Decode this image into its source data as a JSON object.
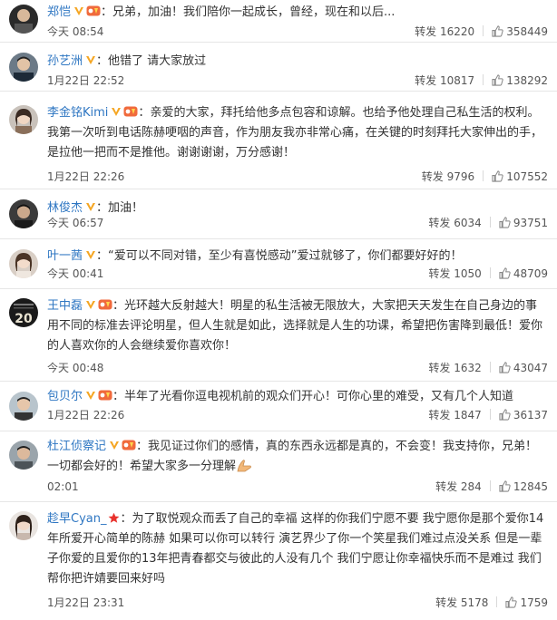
{
  "labels": {
    "repost": "转发"
  },
  "colors": {
    "username": "#2e76c2",
    "vip_badge": "#f5a623",
    "svip_badge": "#f06a3c",
    "star": "#e8322d"
  },
  "comments": [
    {
      "user": "郑恺",
      "badges": [
        "v-icon",
        "svip-icon"
      ],
      "text": "兄弟，加油！我们陪你一起成长，曾经，现在和以后...",
      "time": "今天 08:54",
      "repost_count": "16220",
      "likes": "358449"
    },
    {
      "user": "孙艺洲",
      "badges": [
        "v-icon"
      ],
      "text": "他错了 请大家放过",
      "time": "1月22日 22:52",
      "repost_count": "10817",
      "likes": "138292"
    },
    {
      "user": "李金铭Kimi",
      "badges": [
        "v-icon",
        "svip-icon"
      ],
      "text": "亲爱的大家，拜托给他多点包容和谅解。也给予他处理自己私生活的权利。我第一次听到电话陈赫哽咽的声音，作为朋友我亦非常心痛，在关键的时刻拜托大家伸出的手，是拉他一把而不是推他。谢谢谢谢，万分感谢！",
      "time": "1月22日 22:26",
      "repost_count": "9796",
      "likes": "107552"
    },
    {
      "user": "林俊杰",
      "badges": [
        "v-icon"
      ],
      "text": "加油！",
      "time": "今天 06:57",
      "repost_count": "6034",
      "likes": "93751"
    },
    {
      "user": "叶一茜",
      "badges": [
        "v-icon"
      ],
      "text": "“爱可以不同对错，至少有喜悦感动”爱过就够了，你们都要好好的！",
      "time": "今天 00:41",
      "repost_count": "1050",
      "likes": "48709"
    },
    {
      "user": "王中磊",
      "badges": [
        "v-icon",
        "svip-icon"
      ],
      "text": "光环越大反射越大！明星的私生活被无限放大，大家把天天发生在自己身边的事用不同的标准去评论明星，但人生就是如此，选择就是人生的功课，希望把伤害降到最低！爱你的人喜欢你的人会继续爱你喜欢你！",
      "time": "今天 00:48",
      "repost_count": "1632",
      "likes": "43047"
    },
    {
      "user": "包贝尔",
      "badges": [
        "v-icon",
        "svip-icon"
      ],
      "text": "半年了光看你逗电视机前的观众们开心！可你心里的难受，又有几个人知道",
      "time": "1月22日 22:26",
      "repost_count": "1847",
      "likes": "36137"
    },
    {
      "user": "杜江侦察记",
      "badges": [
        "v-icon",
        "svip-icon"
      ],
      "text": "我见证过你们的感情，真的东西永远都是真的，不会变！我支持你，兄弟！一切都会好的！希望大家多一分理解",
      "emoji": "pray-hands-icon",
      "time": "02:01",
      "repost_count": "284",
      "likes": "12845"
    },
    {
      "user": "趁早Cyan_",
      "badges": [
        "star-icon"
      ],
      "text": "为了取悦观众而丢了自己的幸福 这样的你我们宁愿不要 我宁愿你是那个爱你14年所爱开心简单的陈赫 如果可以你可以转行 演艺界少了你一个笑星我们难过点没关系 但是一辈子你爱的且爱你的13年把青春都交与彼此的人没有几个 我们宁愿让你幸福快乐而不是难过 我们帮你把许婧要回来好吗",
      "time": "1月22日 23:31",
      "repost_count": "5178",
      "likes": "1759"
    }
  ]
}
